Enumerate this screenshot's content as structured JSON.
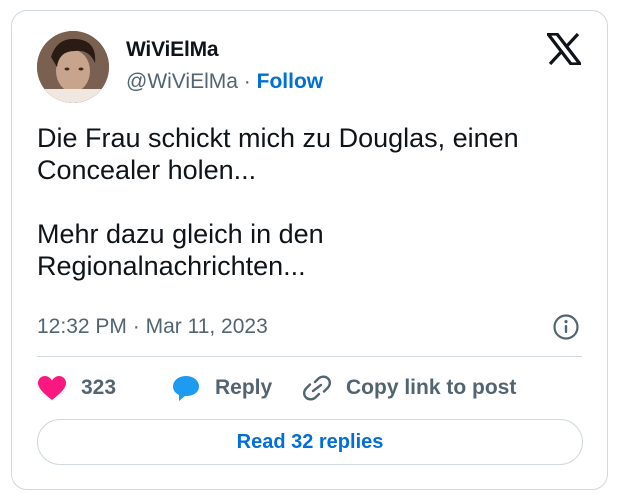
{
  "author": {
    "name": "WiViElMa",
    "handle": "@WiViElMa",
    "separator": "·",
    "follow_label": "Follow"
  },
  "tweet": {
    "text": "Die Frau schickt mich zu Douglas, einen\nConcealer holen...\n\nMehr dazu gleich in den\nRegionalnachrichten...",
    "time": "12:32 PM",
    "date_separator": "·",
    "date": "Mar 11, 2023"
  },
  "actions": {
    "like_count": "323",
    "reply_label": "Reply",
    "copy_link_label": "Copy link to post"
  },
  "read_replies_label": "Read 32 replies",
  "icons": {
    "logo": "x-logo-icon",
    "info": "info-icon",
    "like": "heart-icon",
    "reply": "speech-bubble-icon",
    "link": "link-icon"
  },
  "colors": {
    "accent": "#006fd6",
    "heart": "#f91880",
    "reply_bubble": "#1d9bf0",
    "secondary_text": "#536471",
    "border": "#cfd9de"
  }
}
